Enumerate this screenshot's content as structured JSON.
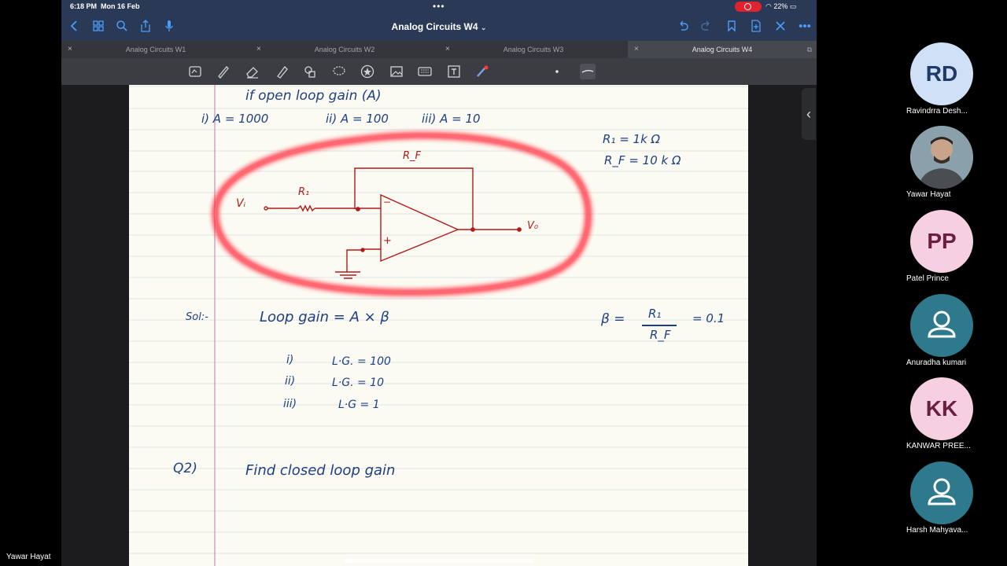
{
  "status": {
    "time": "6:18 PM",
    "date": "Mon 16 Feb",
    "battery": "22%"
  },
  "app": {
    "title": "Analog Circuits W4",
    "title_chevron": "⌄"
  },
  "tabs": [
    {
      "label": "Analog Circuits W1",
      "active": false
    },
    {
      "label": "Analog Circuits W2",
      "active": false
    },
    {
      "label": "Analog Circuits W3",
      "active": false
    },
    {
      "label": "Analog Circuits W4",
      "active": true
    }
  ],
  "tab_close_glyph": "×",
  "toolbar_icons": [
    "scan-icon",
    "pen-icon",
    "eraser-icon",
    "highlighter-icon",
    "shapes-icon",
    "lasso-icon",
    "star-icon",
    "image-icon",
    "keyboard-icon",
    "text-icon",
    "laser-icon"
  ],
  "notes": {
    "line_top": "if   open   loop   gain  (A)",
    "opt1": "i)   A = 1000",
    "opt2": "ii) A = 100",
    "opt3": "iii) A = 10",
    "r1_given": "R₁ =  1k Ω",
    "rf_given": "R_F =  10 k Ω",
    "circuit": {
      "rf": "R_F",
      "r1": "R₁",
      "vi": "Vᵢ",
      "vo": "V₀",
      "minus": "−",
      "plus": "+"
    },
    "sol": "Sol:-",
    "loop_gain": "Loop    gain    =     A   ×   β",
    "beta_lhs": "β =",
    "beta_num": "R₁",
    "beta_den": "R_F",
    "beta_val": "= 0.1",
    "lg1_idx": "i)",
    "lg1": "L·G.   =  100",
    "lg2_idx": "ii)",
    "lg2": "L·G.   =  10",
    "lg3_idx": "iii)",
    "lg3": "L·G  =   1",
    "q2": "Q2)",
    "q2_text": "Find   closed   loop   gain"
  },
  "participants": [
    {
      "initials": "RD",
      "name": "Ravindrra  Desh...",
      "bg": "#cfe0f7",
      "fg": "#1f3a66"
    },
    {
      "initials": "",
      "name": "Yawar Hayat",
      "bg": "#6a7f8c",
      "fg": "#fff",
      "photo": true
    },
    {
      "initials": "PP",
      "name": "Patel Prince",
      "bg": "#f6cfe0",
      "fg": "#6b1f3e"
    },
    {
      "initials": "",
      "name": "Anuradha kumari",
      "bg": "#2e7a8c",
      "fg": "#fff",
      "person_icon": true
    },
    {
      "initials": "KK",
      "name": "KANWAR PREE...",
      "bg": "#f6cfe0",
      "fg": "#6b1f3e"
    },
    {
      "initials": "",
      "name": "Harsh  Mahyava...",
      "bg": "#2e7a8c",
      "fg": "#fff",
      "person_icon": true
    }
  ],
  "self_name": "Yawar Hayat",
  "colors": {
    "ink_blue": "#1f3f85",
    "ink_red": "#b41a1a",
    "highlight": "#ff1e2e",
    "link_blue": "#4a9df8"
  }
}
